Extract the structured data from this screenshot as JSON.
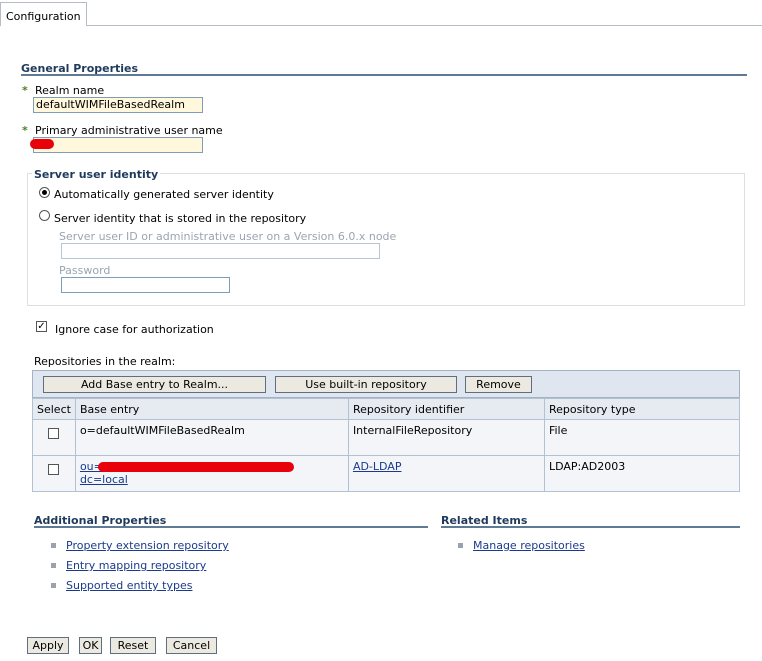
{
  "tab": {
    "label": "Configuration"
  },
  "general": {
    "title": "General Properties",
    "realm_name": {
      "label": "Realm name",
      "value": "defaultWIMFileBasedRealm"
    },
    "admin_user": {
      "label": "Primary administrative user name",
      "value": ""
    }
  },
  "server_identity": {
    "legend": "Server user identity",
    "auto_label": "Automatically generated server identity",
    "stored_label": "Server identity that is stored in the repository",
    "user_id_label": "Server user ID or administrative user on a Version 6.0.x node",
    "user_id_value": "",
    "password_label": "Password",
    "password_value": ""
  },
  "ignore_case": {
    "label": "Ignore case for authorization",
    "checked": true
  },
  "repositories": {
    "label": "Repositories in the realm:",
    "buttons": {
      "add": "Add Base entry to Realm...",
      "builtin": "Use built-in repository",
      "remove": "Remove"
    },
    "columns": [
      "Select",
      "Base entry",
      "Repository identifier",
      "Repository type"
    ],
    "rows": [
      {
        "base": "o=defaultWIMFileBasedRealm",
        "id": "InternalFileRepository",
        "type": "File"
      },
      {
        "base_prefix": "ou=",
        "base_suffix": "dc=local",
        "id": "AD-LDAP",
        "type": "LDAP:AD2003"
      }
    ]
  },
  "additional": {
    "title": "Additional Properties",
    "links": [
      "Property extension repository",
      "Entry mapping repository",
      "Supported entity types"
    ]
  },
  "related": {
    "title": "Related Items",
    "links": [
      "Manage repositories"
    ]
  },
  "footer": {
    "apply": "Apply",
    "ok": "OK",
    "reset": "Reset",
    "cancel": "Cancel"
  },
  "colors": {
    "required": "#4f7d24",
    "title": "#1f3a5c",
    "link": "#1a3b8d",
    "redaction": "#e8000a"
  },
  "icons": {
    "required": "required-asterisk-icon",
    "bullet": "bullet-icon"
  }
}
